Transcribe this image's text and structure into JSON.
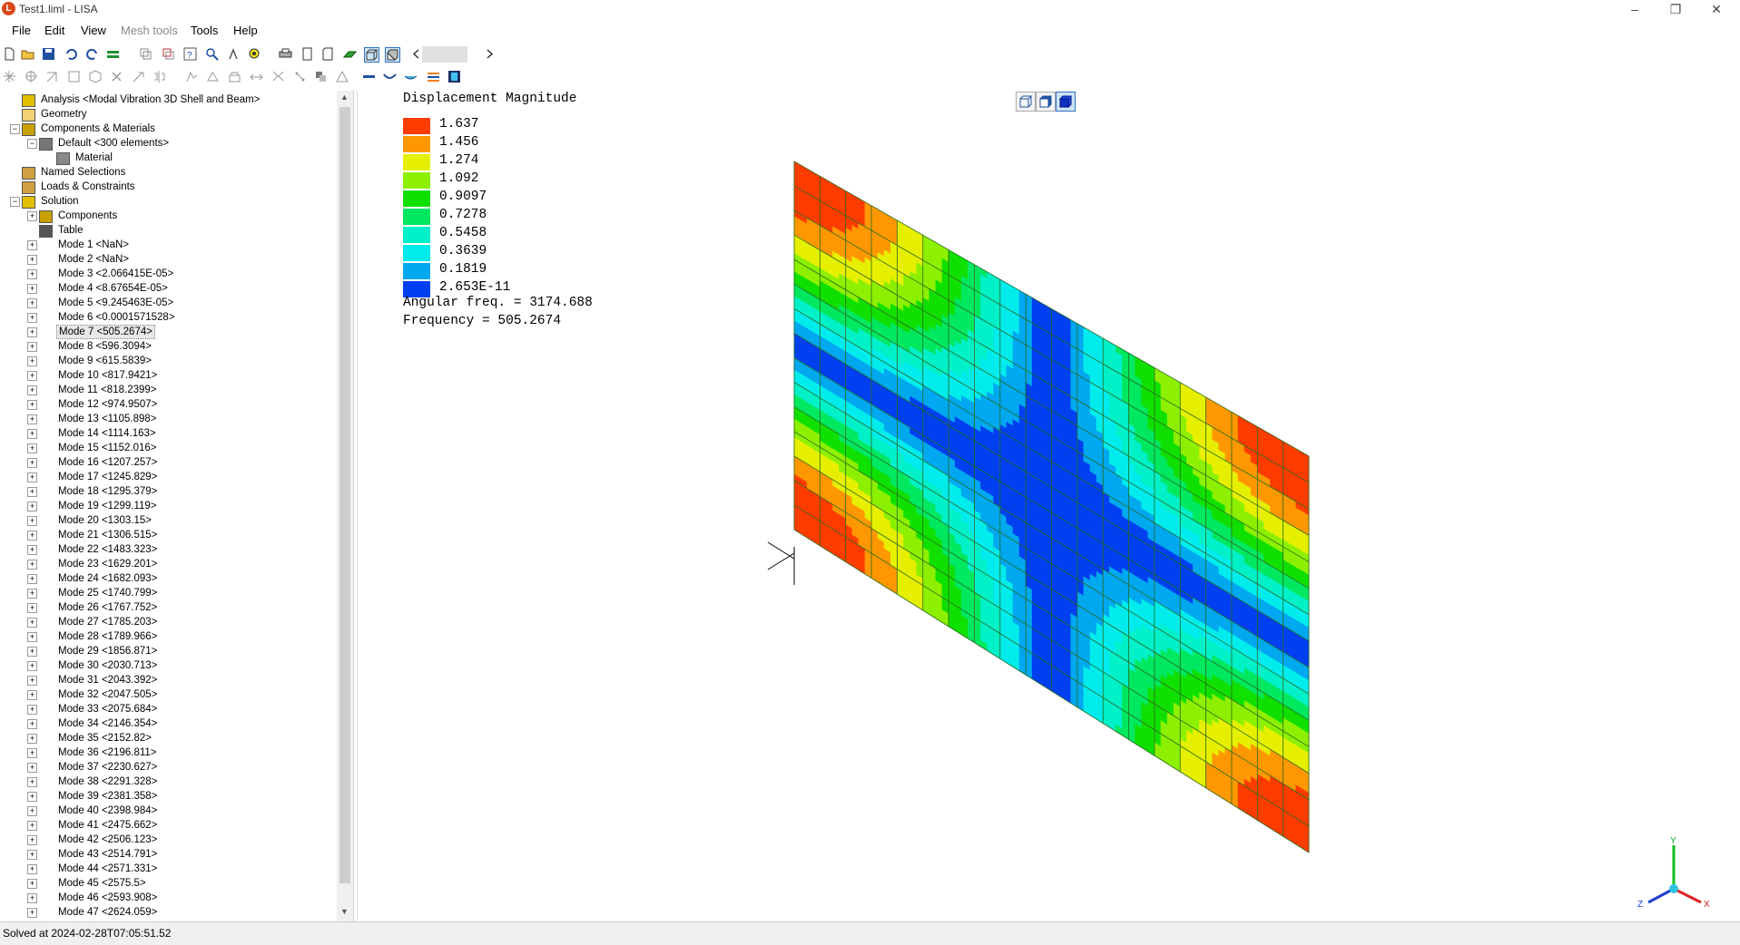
{
  "window": {
    "title": "Test1.liml - LISA",
    "app_icon_letter": "L",
    "controls": {
      "minimize": "–",
      "maximize": "❐",
      "close": "✕"
    }
  },
  "menu": {
    "items": [
      {
        "label": "File",
        "enabled": true
      },
      {
        "label": "Edit",
        "enabled": true
      },
      {
        "label": "View",
        "enabled": true
      },
      {
        "label": "Mesh tools",
        "enabled": false
      },
      {
        "label": "Tools",
        "enabled": true
      },
      {
        "label": "Help",
        "enabled": true
      }
    ]
  },
  "toolbar1": {
    "icons": [
      "new-icon",
      "open-icon",
      "save-icon",
      "undo-icon",
      "redo-icon",
      "equals-icon",
      "copy-node-icon",
      "paste-node-icon",
      "query-icon",
      "zoom-icon",
      "run-icon",
      "zoom-fit-icon",
      "print-icon",
      "page-icon",
      "page2-icon",
      "surface-icon",
      "wire-box-icon",
      "solid-box-icon",
      "scroll-left-icon",
      "scroll-right-icon"
    ]
  },
  "toolbar2": {
    "icons": [
      "node-icon",
      "select-icon",
      "move-icon",
      "box-icon",
      "solid-icon",
      "delete-icon",
      "split-icon",
      "mirror-icon",
      "extrude-icon",
      "revolve-icon",
      "sweep-icon",
      "loft-icon",
      "refine-icon",
      "merge-icon",
      "fill-icon",
      "triangle-icon",
      "beam-icon",
      "shell-icon",
      "shell2-icon",
      "orient-icon",
      "film-icon"
    ]
  },
  "tree": {
    "items": [
      {
        "label": "Analysis <Modal Vibration 3D Shell and Beam>",
        "level": 0,
        "icon": "analysis-icon",
        "expander": ""
      },
      {
        "label": "Geometry",
        "level": 0,
        "icon": "geometry-folder-icon",
        "expander": ""
      },
      {
        "label": "Components & Materials",
        "level": 0,
        "icon": "components-icon",
        "expander": "−"
      },
      {
        "label": "Default <300 elements>",
        "level": 1,
        "icon": "component-icon",
        "expander": "−"
      },
      {
        "label": "Material",
        "level": 2,
        "icon": "material-icon",
        "expander": ""
      },
      {
        "label": "Named Selections",
        "level": 0,
        "icon": "named-selections-icon",
        "expander": ""
      },
      {
        "label": "Loads & Constraints",
        "level": 0,
        "icon": "loads-icon",
        "expander": ""
      },
      {
        "label": "Solution",
        "level": 0,
        "icon": "solution-icon",
        "expander": "−"
      },
      {
        "label": "Components",
        "level": 1,
        "icon": "components-icon",
        "expander": "+"
      },
      {
        "label": "Table",
        "level": 1,
        "icon": "table-icon",
        "expander": ""
      },
      {
        "label": "Mode 1 <NaN>",
        "level": 1,
        "icon": "",
        "expander": "+"
      },
      {
        "label": "Mode 2 <NaN>",
        "level": 1,
        "icon": "",
        "expander": "+"
      },
      {
        "label": "Mode 3 <2.066415E-05>",
        "level": 1,
        "icon": "",
        "expander": "+"
      },
      {
        "label": "Mode 4 <8.67654E-05>",
        "level": 1,
        "icon": "",
        "expander": "+"
      },
      {
        "label": "Mode 5 <9.245463E-05>",
        "level": 1,
        "icon": "",
        "expander": "+"
      },
      {
        "label": "Mode 6 <0.0001571528>",
        "level": 1,
        "icon": "",
        "expander": "+"
      },
      {
        "label": "Mode 7 <505.2674>",
        "level": 1,
        "icon": "",
        "expander": "+",
        "selected": true
      },
      {
        "label": "Mode 8 <596.3094>",
        "level": 1,
        "icon": "",
        "expander": "+"
      },
      {
        "label": "Mode 9 <615.5839>",
        "level": 1,
        "icon": "",
        "expander": "+"
      },
      {
        "label": "Mode 10 <817.9421>",
        "level": 1,
        "icon": "",
        "expander": "+"
      },
      {
        "label": "Mode 11 <818.2399>",
        "level": 1,
        "icon": "",
        "expander": "+"
      },
      {
        "label": "Mode 12 <974.9507>",
        "level": 1,
        "icon": "",
        "expander": "+"
      },
      {
        "label": "Mode 13 <1105.898>",
        "level": 1,
        "icon": "",
        "expander": "+"
      },
      {
        "label": "Mode 14 <1114.163>",
        "level": 1,
        "icon": "",
        "expander": "+"
      },
      {
        "label": "Mode 15 <1152.016>",
        "level": 1,
        "icon": "",
        "expander": "+"
      },
      {
        "label": "Mode 16 <1207.257>",
        "level": 1,
        "icon": "",
        "expander": "+"
      },
      {
        "label": "Mode 17 <1245.829>",
        "level": 1,
        "icon": "",
        "expander": "+"
      },
      {
        "label": "Mode 18 <1295.379>",
        "level": 1,
        "icon": "",
        "expander": "+"
      },
      {
        "label": "Mode 19 <1299.119>",
        "level": 1,
        "icon": "",
        "expander": "+"
      },
      {
        "label": "Mode 20 <1303.15>",
        "level": 1,
        "icon": "",
        "expander": "+"
      },
      {
        "label": "Mode 21 <1306.515>",
        "level": 1,
        "icon": "",
        "expander": "+"
      },
      {
        "label": "Mode 22 <1483.323>",
        "level": 1,
        "icon": "",
        "expander": "+"
      },
      {
        "label": "Mode 23 <1629.201>",
        "level": 1,
        "icon": "",
        "expander": "+"
      },
      {
        "label": "Mode 24 <1682.093>",
        "level": 1,
        "icon": "",
        "expander": "+"
      },
      {
        "label": "Mode 25 <1740.799>",
        "level": 1,
        "icon": "",
        "expander": "+"
      },
      {
        "label": "Mode 26 <1767.752>",
        "level": 1,
        "icon": "",
        "expander": "+"
      },
      {
        "label": "Mode 27 <1785.203>",
        "level": 1,
        "icon": "",
        "expander": "+"
      },
      {
        "label": "Mode 28 <1789.966>",
        "level": 1,
        "icon": "",
        "expander": "+"
      },
      {
        "label": "Mode 29 <1856.871>",
        "level": 1,
        "icon": "",
        "expander": "+"
      },
      {
        "label": "Mode 30 <2030.713>",
        "level": 1,
        "icon": "",
        "expander": "+"
      },
      {
        "label": "Mode 31 <2043.392>",
        "level": 1,
        "icon": "",
        "expander": "+"
      },
      {
        "label": "Mode 32 <2047.505>",
        "level": 1,
        "icon": "",
        "expander": "+"
      },
      {
        "label": "Mode 33 <2075.684>",
        "level": 1,
        "icon": "",
        "expander": "+"
      },
      {
        "label": "Mode 34 <2146.354>",
        "level": 1,
        "icon": "",
        "expander": "+"
      },
      {
        "label": "Mode 35 <2152.82>",
        "level": 1,
        "icon": "",
        "expander": "+"
      },
      {
        "label": "Mode 36 <2196.811>",
        "level": 1,
        "icon": "",
        "expander": "+"
      },
      {
        "label": "Mode 37 <2230.627>",
        "level": 1,
        "icon": "",
        "expander": "+"
      },
      {
        "label": "Mode 38 <2291.328>",
        "level": 1,
        "icon": "",
        "expander": "+"
      },
      {
        "label": "Mode 39 <2381.358>",
        "level": 1,
        "icon": "",
        "expander": "+"
      },
      {
        "label": "Mode 40 <2398.984>",
        "level": 1,
        "icon": "",
        "expander": "+"
      },
      {
        "label": "Mode 41 <2475.662>",
        "level": 1,
        "icon": "",
        "expander": "+"
      },
      {
        "label": "Mode 42 <2506.123>",
        "level": 1,
        "icon": "",
        "expander": "+"
      },
      {
        "label": "Mode 43 <2514.791>",
        "level": 1,
        "icon": "",
        "expander": "+"
      },
      {
        "label": "Mode 44 <2571.331>",
        "level": 1,
        "icon": "",
        "expander": "+"
      },
      {
        "label": "Mode 45 <2575.5>",
        "level": 1,
        "icon": "",
        "expander": "+"
      },
      {
        "label": "Mode 46 <2593.908>",
        "level": 1,
        "icon": "",
        "expander": "+"
      },
      {
        "label": "Mode 47 <2624.059>",
        "level": 1,
        "icon": "",
        "expander": "+"
      }
    ],
    "scroll": {
      "up": "▲",
      "down": "▼"
    }
  },
  "legend": {
    "title": "Displacement Magnitude",
    "entries": [
      {
        "value": "1.637",
        "color": "#ff3c00"
      },
      {
        "value": "1.456",
        "color": "#ff9800"
      },
      {
        "value": "1.274",
        "color": "#e6ef00"
      },
      {
        "value": "1.092",
        "color": "#8cf000"
      },
      {
        "value": "0.9097",
        "color": "#10e000"
      },
      {
        "value": "0.7278",
        "color": "#00e860"
      },
      {
        "value": "0.5458",
        "color": "#00f0c8"
      },
      {
        "value": "0.3639",
        "color": "#00ecec"
      },
      {
        "value": "0.1819",
        "color": "#00a8f0"
      },
      {
        "value": "2.653E-11",
        "color": "#0040f0"
      }
    ],
    "angular_freq": "Angular freq. = 3174.688",
    "frequency": "Frequency = 505.2674"
  },
  "triad": {
    "x": "X",
    "y": "Y",
    "z": "Z"
  },
  "status": {
    "text": "Solved at 2024-02-28T07:05:51.52"
  }
}
